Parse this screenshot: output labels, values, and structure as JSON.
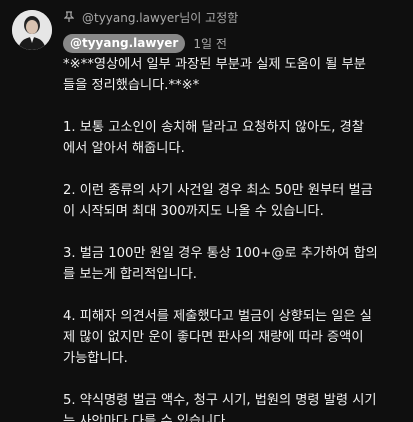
{
  "pinned": {
    "icon": "pin-icon",
    "text": "@tyyang.lawyer님이 고정함"
  },
  "comment": {
    "author": "@tyyang.lawyer",
    "timestamp": "1일 전",
    "lines": [
      "*※**영상에서 일부 과장된 부분과 실제 도움이 될 부분",
      "들을 정리했습니다.**※*",
      "",
      "1. 보통 고소인이 송치해 달라고 요청하지 않아도, 경찰",
      "에서 알아서 해줍니다.",
      "",
      "2. 이런 종류의 사기 사건일 경우 최소 50만 원부터 벌금",
      "이 시작되며 최대 300까지도 나올 수 있습니다.",
      "",
      "3. 벌금 100만 원일 경우 통상 100+@로 추가하여 합의",
      "를 보는게 합리적입니다.",
      "",
      "4. 피해자 의견서를 제출했다고 벌금이 상향되는 일은 실",
      "제 많이 없지만 운이 좋다면 판사의 재량에 따라 증액이",
      "가능합니다.",
      "",
      "5. 약식명령 벌금 액수, 청구 시기, 법원의 명령 발령 시기",
      "는 사안마다 다를 수 있습니다."
    ]
  }
}
